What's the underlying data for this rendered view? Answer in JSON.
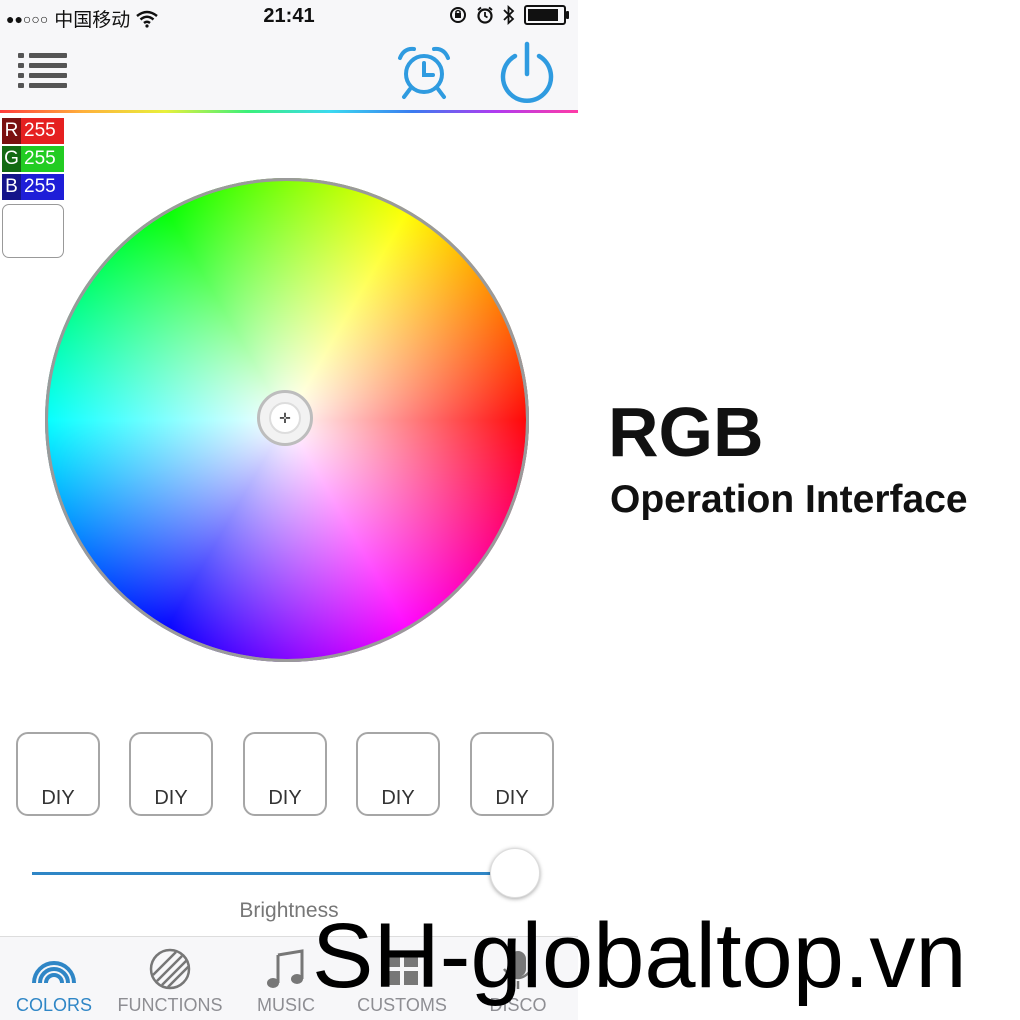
{
  "status_bar": {
    "signal": "●●○○○",
    "carrier": "中国移动",
    "time": "21:41"
  },
  "nav": {
    "menu_icon": "list-icon",
    "alarm_icon": "alarm-clock-icon",
    "power_icon": "power-icon",
    "accent_color": "#2f86c6"
  },
  "rgb_readout": {
    "r_label": "R",
    "r_value": "255",
    "g_label": "G",
    "g_value": "255",
    "b_label": "B",
    "b_value": "255",
    "current_color": "#ffffff"
  },
  "diy_buttons": [
    "DIY",
    "DIY",
    "DIY",
    "DIY",
    "DIY"
  ],
  "brightness": {
    "label": "Brightness",
    "level_fraction": 1.0
  },
  "tabs": [
    {
      "label": "COLORS",
      "icon": "rainbow-icon",
      "active": true
    },
    {
      "label": "FUNCTIONS",
      "icon": "striped-circle-icon",
      "active": false
    },
    {
      "label": "MUSIC",
      "icon": "music-note-icon",
      "active": false
    },
    {
      "label": "CUSTOMS",
      "icon": "grid-icon",
      "active": false
    },
    {
      "label": "DISCO",
      "icon": "microphone-icon",
      "active": false
    }
  ],
  "promo": {
    "title": "RGB",
    "subtitle": "Operation Interface",
    "watermark": "SH-globaltop.vn"
  }
}
